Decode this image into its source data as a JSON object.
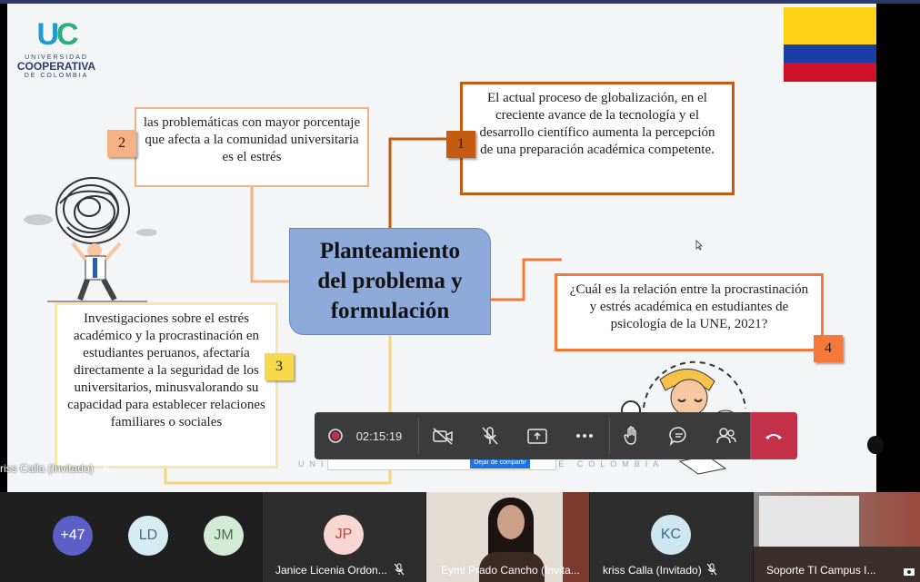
{
  "slide": {
    "logo": {
      "line1": "UNIVERSIDAD",
      "line2": "COOPERATIVA",
      "line3": "DE COLOMBIA"
    },
    "center_title": [
      "Planteamiento",
      "del problema y",
      "formulación"
    ],
    "box1": {
      "number": "1",
      "text": "El actual proceso de globalización, en el creciente avance de la tecnología y el desarrollo científico aumenta la percepción de una preparación académica competente."
    },
    "box2": {
      "number": "2",
      "text": "las problemáticas con mayor porcentaje que afecta a la comunidad universitaria es el estrés"
    },
    "box3": {
      "number": "3",
      "text": "Investigaciones sobre el estrés académico y la procrastinación en estudiantes peruanos, afectaría directamente a la seguridad de los universitarios, minusvalorando su capacidad para establecer relaciones familiares o sociales"
    },
    "box4": {
      "number": "4",
      "text": "¿Cuál es la relación entre la procrastinación y estrés académica en estudiantes de psicología de la UNE, 2021?"
    },
    "watermark_footer": "UNIVERSIDAD COOPERATIVA DE COLOMBIA",
    "share_bar_button": "Dejar de compartir",
    "overlay_name": "kriss Calla (Invitado)"
  },
  "toolbar": {
    "timer": "02:15:19",
    "colors": {
      "record": "#c4314b",
      "hangup": "#c4314b"
    }
  },
  "participants": {
    "overflow_count": "+47",
    "tiles": [
      {
        "initials": "LD",
        "name": ""
      },
      {
        "initials": "JM",
        "name": ""
      },
      {
        "initials": "JP",
        "name": "Janice Licenia Ordon..."
      },
      {
        "initials": "",
        "name": "Eymi Prado Cancho (Invita..."
      },
      {
        "initials": "KC",
        "name": "kriss Calla (Invitado)"
      },
      {
        "initials": "",
        "name": "Soporte TI Campus I..."
      }
    ]
  }
}
